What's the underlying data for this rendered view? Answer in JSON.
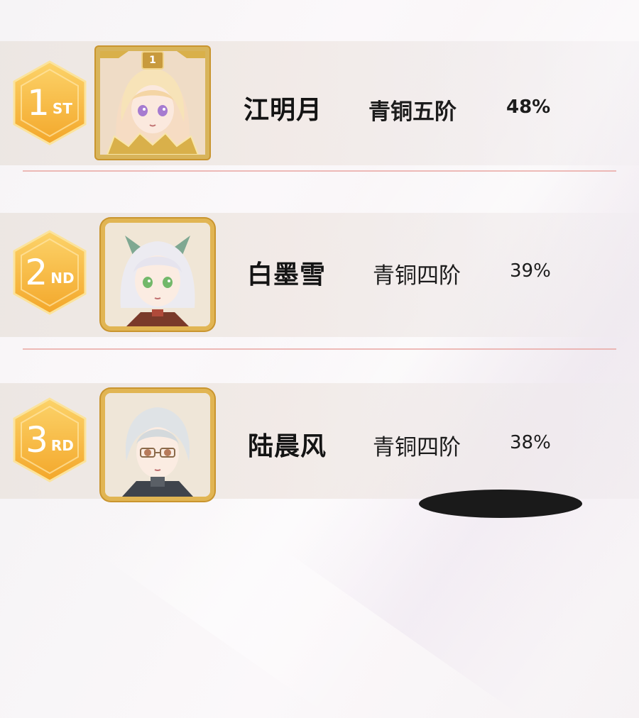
{
  "leaderboard": {
    "entries": [
      {
        "rank_number": "1",
        "rank_suffix": "ST",
        "frame_rank_label": "1",
        "name": "江明月",
        "rank_title": "青铜五阶",
        "percent": "48%",
        "badge_color": "#f6b73c",
        "avatar": "pink-haired-girl-avatar"
      },
      {
        "rank_number": "2",
        "rank_suffix": "ND",
        "name": "白墨雪",
        "rank_title": "青铜四阶",
        "percent": "39%",
        "badge_color": "#f6b73c",
        "avatar": "white-haired-girl-avatar"
      },
      {
        "rank_number": "3",
        "rank_suffix": "RD",
        "name": "陆晨风",
        "rank_title": "青铜四阶",
        "percent": "38%",
        "badge_color": "#f6b73c",
        "avatar": "silver-haired-boy-avatar"
      }
    ]
  },
  "colors": {
    "badge_gold": "#f6b73c",
    "frame_gold": "#e1b553",
    "divider": "#e8a4a0"
  }
}
